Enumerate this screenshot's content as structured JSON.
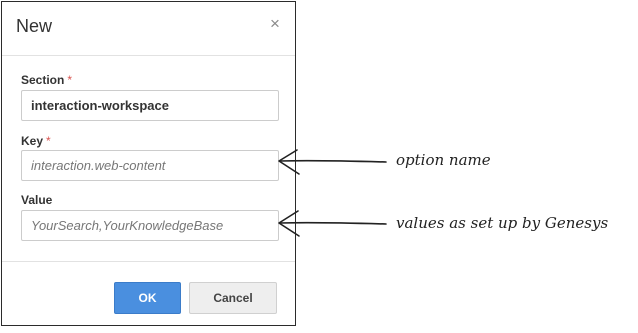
{
  "dialog": {
    "title": "New",
    "close_symbol": "×",
    "fields": {
      "section": {
        "label": "Section",
        "required_mark": "*",
        "value": "interaction-workspace",
        "placeholder": ""
      },
      "key": {
        "label": "Key",
        "required_mark": "*",
        "value": "",
        "placeholder": "interaction.web-content"
      },
      "value": {
        "label": "Value",
        "required_mark": "",
        "value": "",
        "placeholder": "YourSearch,YourKnowledgeBase"
      }
    },
    "buttons": {
      "ok": "OK",
      "cancel": "Cancel"
    }
  },
  "annotations": {
    "key_note": "option name",
    "value_note": "values as set up by Genesys"
  },
  "colors": {
    "ok_button": "#4a8fdf",
    "required_asterisk": "#d9534f",
    "dialog_border": "#2b2b2b"
  },
  "icons": {
    "close": "close-icon",
    "arrow": "arrow-left-icon"
  }
}
